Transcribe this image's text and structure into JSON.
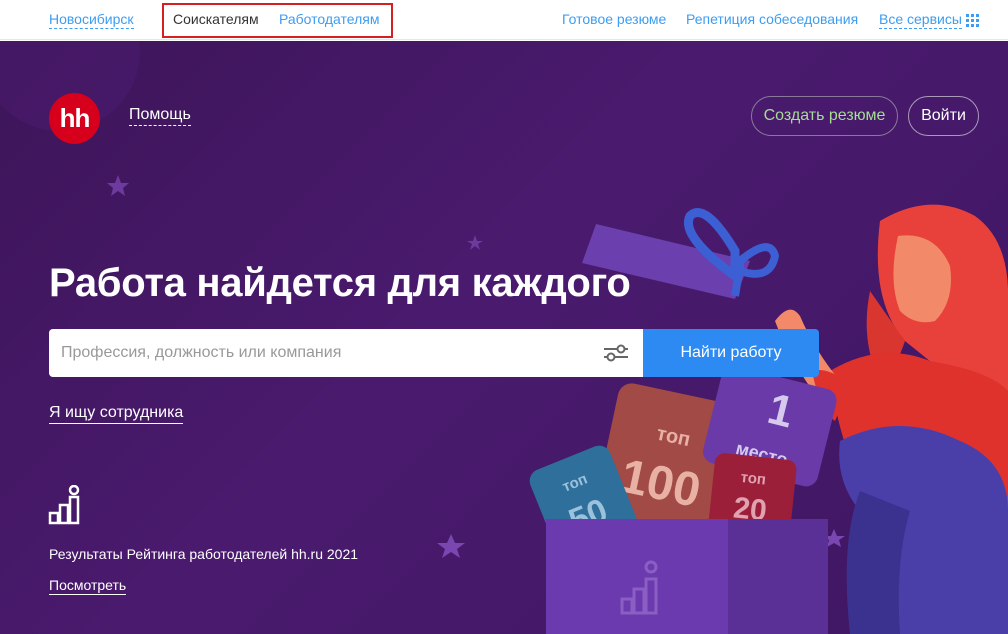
{
  "topbar": {
    "city": "Новосибирск",
    "tab_seekers": "Соискателям",
    "tab_employers": "Работодателям",
    "ready_resume": "Готовое резюме",
    "interview_rehearsal": "Репетиция собеседования",
    "all_services": "Все сервисы"
  },
  "header": {
    "logo": "hh",
    "help": "Помощь",
    "create_resume": "Создать резюме",
    "login": "Войти"
  },
  "hero": {
    "headline": "Работа найдется для каждого",
    "search_placeholder": "Профессия, должность или компания",
    "find_button": "Найти работу",
    "employer_link": "Я ищу сотрудника",
    "rating_text": "Результаты Рейтинга работодателей hh.ru 2021",
    "rating_link": "Посмотреть"
  },
  "illustration": {
    "card_top50_label": "топ",
    "card_top50_value": "50",
    "card_top100_label": "топ",
    "card_top100_value": "100",
    "card_first_value": "1",
    "card_first_label": "место",
    "card_top20_label": "топ",
    "card_top20_value": "20"
  },
  "colors": {
    "link_blue": "#3c9df2",
    "hero_purple": "#4a1a6e",
    "brand_red": "#d6001c",
    "create_green": "#a6dc93",
    "button_blue": "#2c8af2"
  }
}
